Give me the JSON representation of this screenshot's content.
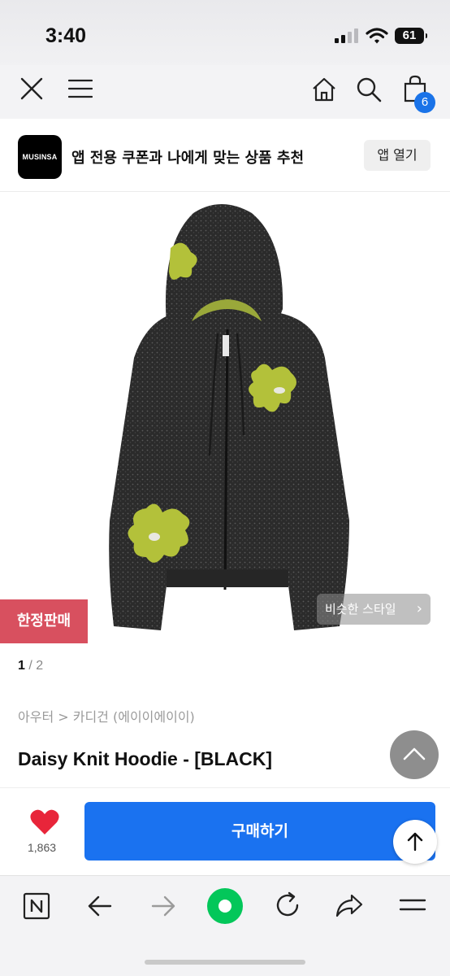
{
  "status_bar": {
    "time": "3:40",
    "battery": "61"
  },
  "nav": {
    "cart_count": "6"
  },
  "banner": {
    "logo_text": "MUSINSA",
    "message": "앱 전용 쿠폰과 나에게 맞는 상품 추천",
    "open_app_label": "앱 열기"
  },
  "gallery": {
    "limited_label": "한정판매",
    "similar_style_label": "비슷한 스타일",
    "current_page": "1",
    "total_pages": "/ 2"
  },
  "product": {
    "breadcrumb": "아우터 > 카디건 (에이이에이이)",
    "title": "Daisy Knit Hoodie - [BLACK]",
    "like_count": "1,863",
    "buy_label": "구매하기"
  },
  "colors": {
    "accent_blue": "#1a72f0",
    "limited_red": "#d8505f",
    "like_red": "#e8253a",
    "naver_green": "#03c75a",
    "knit_charcoal": "#2c2c2c",
    "daisy_yellow": "#b3c13a"
  },
  "icons": [
    "close-icon",
    "menu-icon",
    "home-icon",
    "search-icon",
    "bag-icon",
    "heart-icon",
    "arrow-up-icon",
    "chevron-up-icon",
    "naver-icon",
    "back-icon",
    "forward-icon",
    "naver-green-dot-icon",
    "refresh-icon",
    "share-icon",
    "more-menu-icon"
  ]
}
